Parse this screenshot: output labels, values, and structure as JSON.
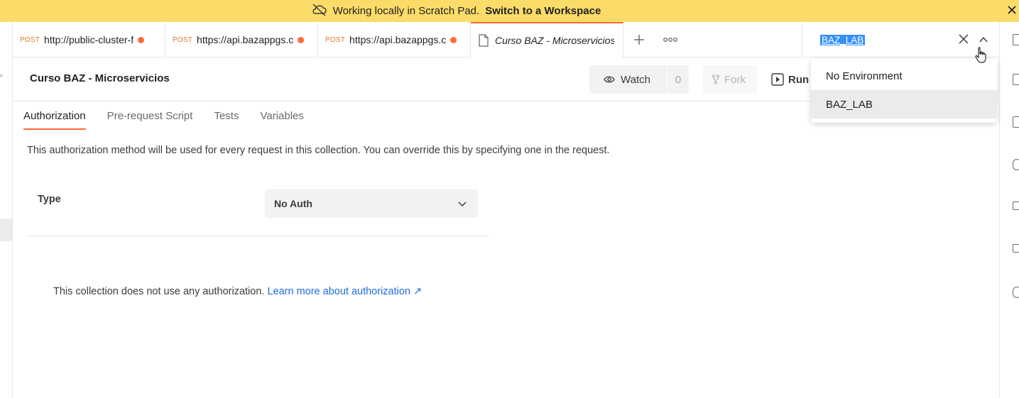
{
  "banner": {
    "text": "Working locally in Scratch Pad.",
    "link": "Switch to a Workspace"
  },
  "tabs": [
    {
      "method": "POST",
      "url": "http://public-cluster-f",
      "unsaved": true
    },
    {
      "method": "POST",
      "url": "https://api.bazappgs.c",
      "unsaved": true
    },
    {
      "method": "POST",
      "url": "https://api.bazappgs.c",
      "unsaved": true
    },
    {
      "method": "",
      "url": "Curso BAZ - Microservicios",
      "unsaved": false,
      "active": true
    }
  ],
  "environment": {
    "selected": "BAZ_LAB",
    "options": [
      "No Environment",
      "BAZ_LAB"
    ]
  },
  "collection": {
    "title": "Curso BAZ - Microservicios",
    "watch_label": "Watch",
    "watch_count": "0",
    "fork_label": "Fork",
    "run_label": "Run"
  },
  "subtabs": [
    "Authorization",
    "Pre-request Script",
    "Tests",
    "Variables"
  ],
  "auth": {
    "description": "This authorization method will be used for every request in this collection. You can override this by specifying one in the request.",
    "type_label": "Type",
    "type_value": "No Auth",
    "no_auth_text": "This collection does not use any authorization.",
    "learn_more": "Learn more about authorization ↗"
  },
  "colors": {
    "banner": "#fcdc68",
    "accent": "#ff6c37",
    "link": "#1d6ed8",
    "method": "#d97b2b"
  }
}
